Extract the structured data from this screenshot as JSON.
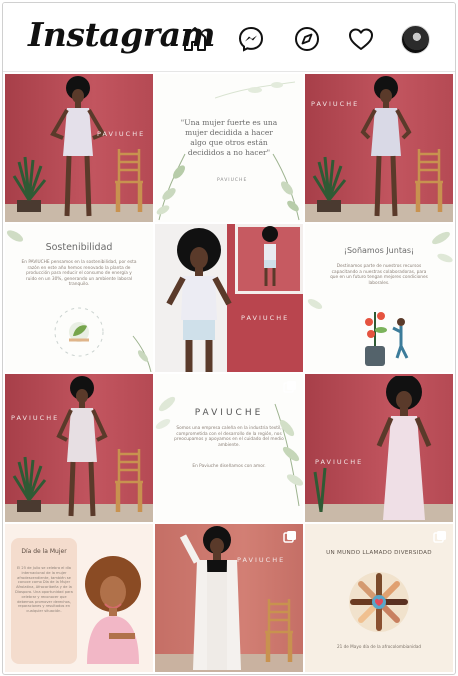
{
  "app": {
    "logo_text": "Instagram"
  },
  "nav": {
    "icons": [
      "home-icon",
      "messenger-icon",
      "explore-icon",
      "activity-heart-icon",
      "profile-avatar"
    ]
  },
  "posts": [
    {
      "kind": "photo",
      "brand": "PAVIUCHE"
    },
    {
      "kind": "quote",
      "quote": "\"Una mujer fuerte es una mujer  decidida a hacer algo que otros  están decididos a no hacer\"",
      "brand": "PAVIUCHE"
    },
    {
      "kind": "photo",
      "brand": "PAVIUCHE"
    },
    {
      "kind": "info",
      "title": "Sostenibilidad",
      "text": "En PAVIUCHE pensamos en la sostenibilidad, por esta razón en este año hemos renovado la planta de producción para reducir el consumo de energía y ruido  en un 30%, generando un ambiente laboral tranquilo."
    },
    {
      "kind": "photo",
      "brand": "PAVIUCHE"
    },
    {
      "kind": "info",
      "title": "¡Soñamos Juntas¡",
      "text": "Destinamos parte de nuestros recursos capacitando a nuestras colaboradoras, para  que en un futuro tengan  mejores condiciones  laborales."
    },
    {
      "kind": "photo",
      "brand": "PAVIUCHE"
    },
    {
      "kind": "about",
      "brand": "PAVIUCHE",
      "text": "Somos una empresa caleña en la industria textil, comprometida con el desarrollo de la región, nos preocupamos y apoyamos en el cuidado del medio ambiente.",
      "text2": "En Paviuche diseñamos con amor."
    },
    {
      "kind": "photo",
      "brand": "PAVIUCHE"
    },
    {
      "kind": "women",
      "title": "Día de la Mujer",
      "text": "El 25 de Julio se celebra el día internacional de la mujer afrodescendiente, también se conoce como Día de la Mujer Afrolatina, Afrocaribeña y de la Diaspora. Una oportunidad para celebrar y reconocer que debemos promover derechos, reparaciones y resultados en cualquier situación."
    },
    {
      "kind": "photo",
      "brand": "PAVIUCHE"
    },
    {
      "kind": "diversity",
      "title": "UN MUNDO LLAMADO DIVERSIDAD",
      "caption": "21 de Mayo día de la afrocolombianidad"
    }
  ],
  "colors": {
    "rose_wall": "#b9454e",
    "cream": "#fdfdfb",
    "text_gray": "#6b6b6b"
  }
}
